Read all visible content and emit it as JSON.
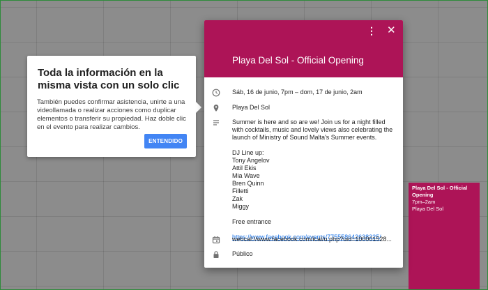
{
  "tooltip": {
    "title": "Toda la información en la misma vista con un solo clic",
    "body": "También puedes confirmar asistencia, unirte a una videollamada o realizar acciones como duplicar elementos o transferir su propiedad. Haz doble clic en el evento para realizar cambios.",
    "button": "ENTENDIDO",
    "button_color": "#4285f4"
  },
  "event_card": {
    "title": "Playa Del Sol - Official Opening",
    "header_color": "#ad1457",
    "icons": {
      "menu": "more-vert-icon",
      "close": "close-icon"
    },
    "date": "Sáb, 16 de junio, 7pm – dom, 17 de junio, 2am",
    "location": "Playa Del Sol",
    "description": {
      "intro": "Summer is here and so are we! Join us for a night filled with cocktails, music and lovely views also celebrating the launch of Ministry of Sound Malta's Summer events.",
      "lineup_heading": "DJ Line up:",
      "lineup": [
        "Tony Angelov",
        "Attil Ekis",
        "Mia Wave",
        "Bren Quinn",
        "Filletti",
        "Zak",
        "Miggy"
      ],
      "free": "Free entrance",
      "link": "https://www.facebook.com/events/775558642638225/"
    },
    "calendar_url": "webcal://www.facebook.com/ical/u.php?uid=100001528...",
    "visibility": "Público"
  },
  "mini_event": {
    "title": "Playa Del Sol - Official Opening",
    "time": "7pm–2am",
    "location": "Playa Del Sol"
  }
}
